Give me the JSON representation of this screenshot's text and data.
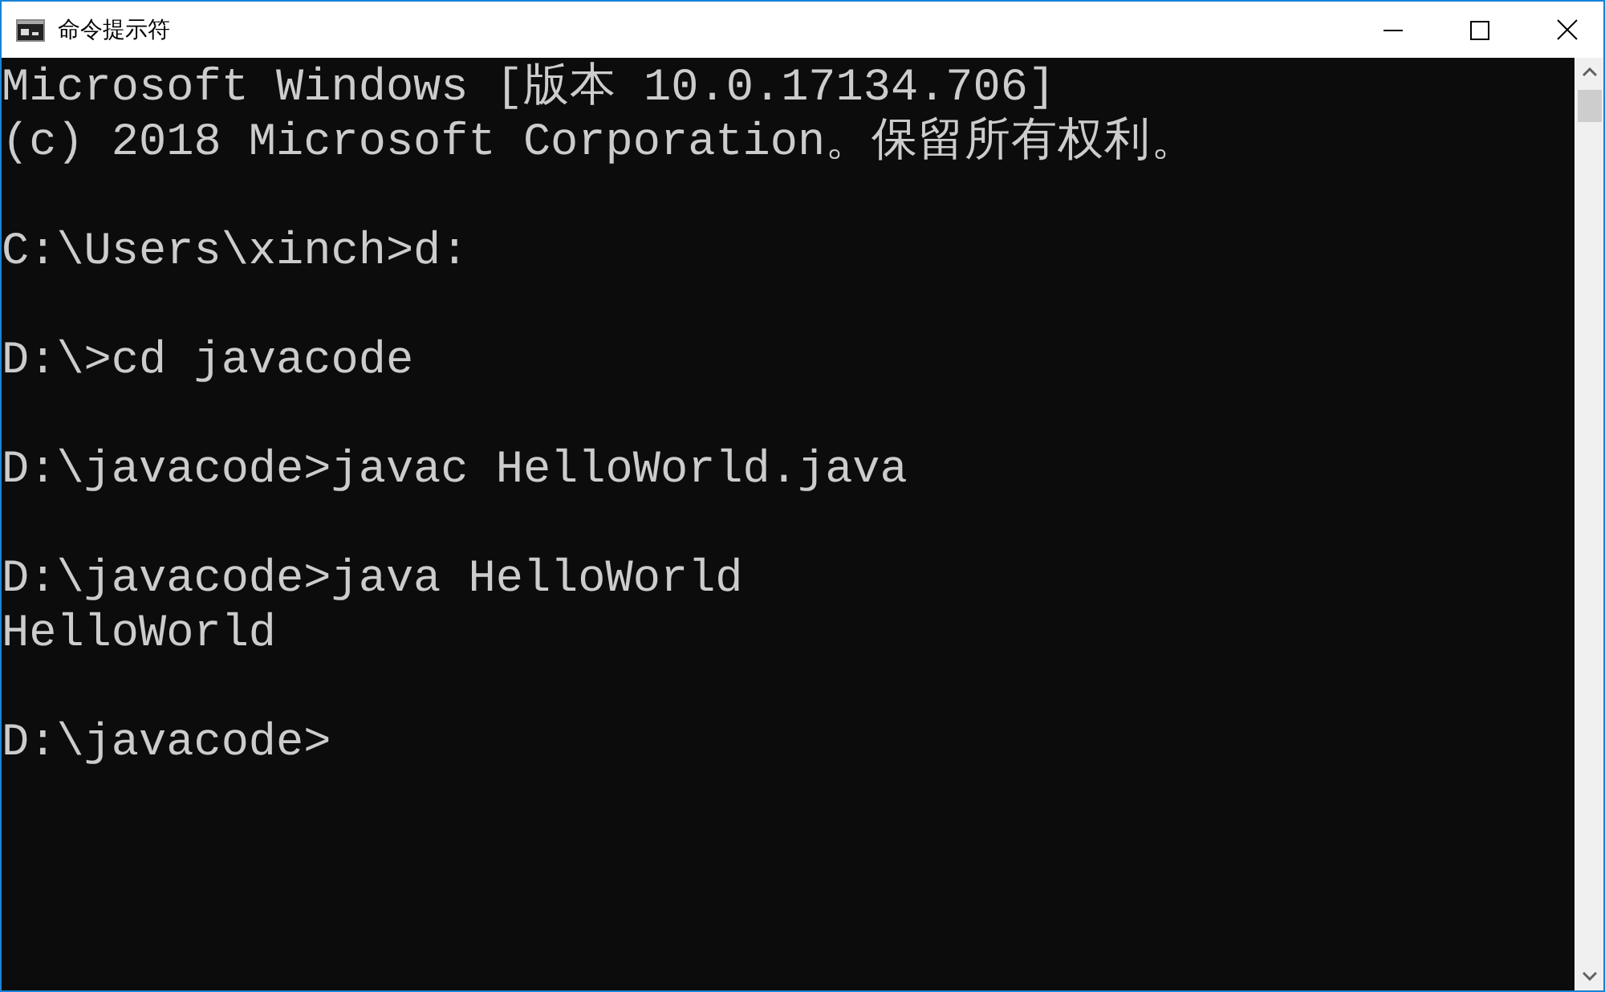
{
  "window": {
    "title": "命令提示符"
  },
  "console": {
    "blocks": [
      [
        "Microsoft Windows [版本 10.0.17134.706]",
        "(c) 2018 Microsoft Corporation。保留所有权利。"
      ],
      [
        "C:\\Users\\xinch>d:"
      ],
      [
        "D:\\>cd javacode"
      ],
      [
        "D:\\javacode>javac HelloWorld.java"
      ],
      [
        "D:\\javacode>java HelloWorld",
        "HelloWorld"
      ],
      [
        "D:\\javacode>"
      ]
    ]
  }
}
